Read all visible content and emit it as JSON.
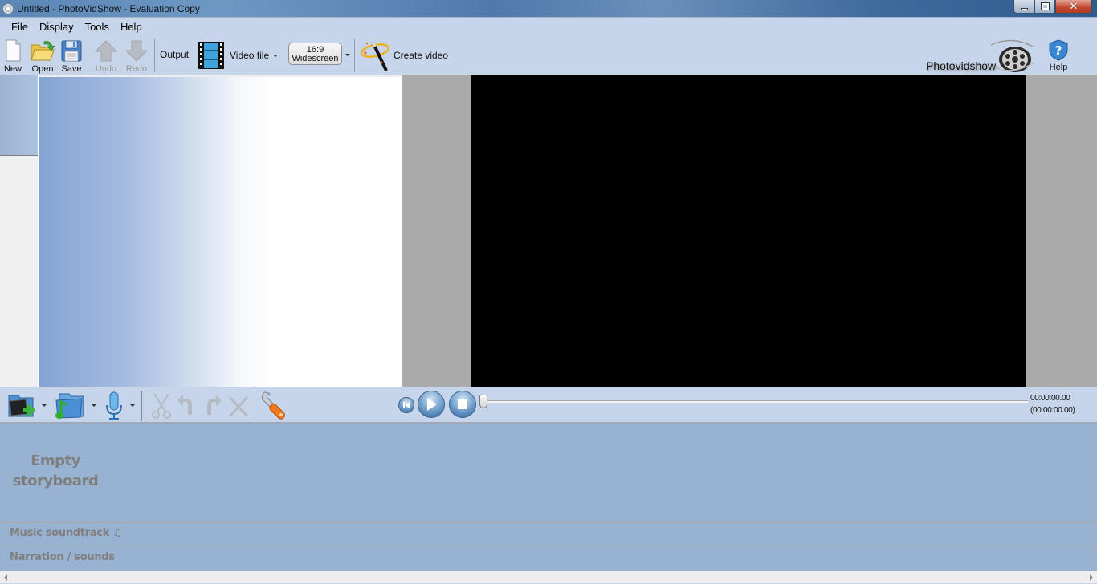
{
  "window": {
    "title": "Untitled - PhotoVidShow - Evaluation Copy",
    "controls": [
      "minimize",
      "restore",
      "close"
    ]
  },
  "menu": {
    "items": [
      {
        "label": "File"
      },
      {
        "label": "Display"
      },
      {
        "label": "Tools"
      },
      {
        "label": "Help"
      }
    ]
  },
  "toolbar": {
    "new_label": "New",
    "open_label": "Open",
    "save_label": "Save",
    "undo_label": "Undo",
    "redo_label": "Redo",
    "output_label": "Output",
    "output_format": "Video file",
    "aspect_ratio": "16:9",
    "aspect_name": "Widescreen",
    "create_video_label": "Create video",
    "brand_text": "Photovidshow",
    "help_label": "Help"
  },
  "storyboard_toolbar": {
    "tools": [
      {
        "icon": "add-pictures-icon",
        "has_dropdown": true,
        "enabled": true
      },
      {
        "icon": "add-music-icon",
        "has_dropdown": true,
        "enabled": true
      },
      {
        "icon": "microphone-icon",
        "has_dropdown": true,
        "enabled": true
      },
      {
        "icon": "scissors-icon",
        "enabled": false
      },
      {
        "icon": "rotate-left-icon",
        "enabled": false
      },
      {
        "icon": "rotate-right-icon",
        "enabled": false
      },
      {
        "icon": "delete-icon",
        "enabled": false
      },
      {
        "icon": "wrench-icon",
        "enabled": true
      }
    ],
    "playback": {
      "position_percent": 0,
      "current_time": "00:00:00.00",
      "total_time": "(00:00:00.00)"
    }
  },
  "storyboard": {
    "empty_line1": "Empty",
    "empty_line2": "storyboard",
    "music_track_label": "Music  soundtrack ♫",
    "narration_track_label": "Narration / sounds"
  },
  "colors": {
    "chrome": "#c7d5ea",
    "storyboard_bg": "#98b2d1",
    "preview_bg": "#aaaaaa",
    "video_bg": "#000000"
  }
}
